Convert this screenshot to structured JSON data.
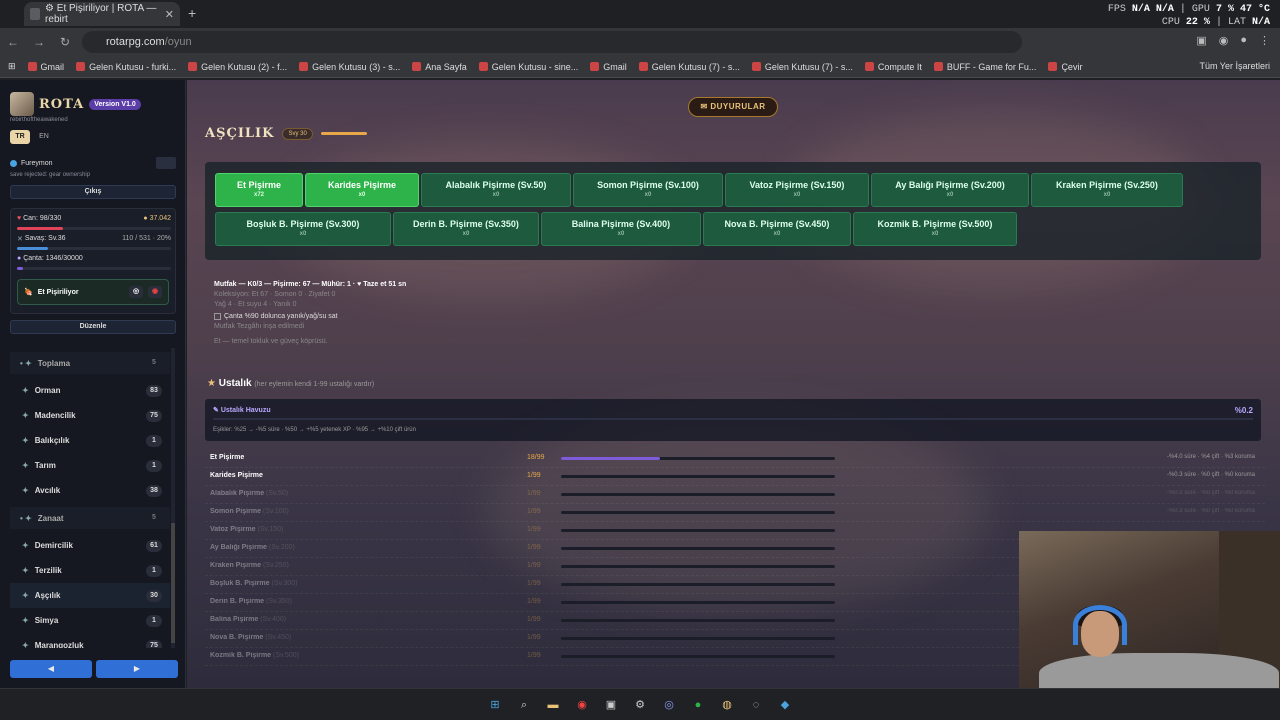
{
  "browser": {
    "tab_title": "⚙ Et Pişiriliyor | ROTA — rebirt",
    "url_host": "rotarpg.com",
    "url_path": "/oyun",
    "overlay": {
      "fps_label": "FPS",
      "fps1": "N/A",
      "fps2": "N/A",
      "gpu_label": "GPU",
      "gpu": "7 %",
      "temp": "47 °C",
      "cpu_label": "CPU",
      "cpu": "22 %",
      "lat_label": "LAT",
      "lat": "N/A"
    },
    "bookmarks": [
      "Gmail",
      "Gelen Kutusu - furki...",
      "Gelen Kutusu (2) - f...",
      "Gelen Kutusu (3) - s...",
      "Ana Sayfa",
      "Gelen Kutusu - sine...",
      "Gmail",
      "Gelen Kutusu (7) - s...",
      "Gelen Kutusu (7) - s...",
      "Compute It",
      "BUFF - Game for Fu...",
      "Çevir"
    ],
    "bookmarks_right": "Tüm Yer İşaretleri"
  },
  "sidebar": {
    "logo": "ROTA",
    "version": "Version V1.0",
    "username_small": "rebirthoftheawakened",
    "lang_tr": "TR",
    "lang_en": "EN",
    "user": "Fureymon",
    "warning": "save rejected: gear ownership",
    "logout": "Çıkış",
    "hp": "Can: 98/330",
    "gold": "37.042",
    "combat": "Savaş: Sv.36",
    "combat_xp": "110 / 531 · 20%",
    "bag": "Çanta: 1346/30000",
    "cooking_status": "Et Pişiriliyor",
    "edit": "Düzenle",
    "skills": [
      {
        "group": true,
        "label": "Toplama",
        "count": "5"
      },
      {
        "label": "Orman",
        "count": "83"
      },
      {
        "label": "Madencilik",
        "count": "75"
      },
      {
        "label": "Balıkçılık",
        "count": "1"
      },
      {
        "label": "Tarım",
        "count": "1"
      },
      {
        "label": "Avcılık",
        "count": "38"
      },
      {
        "group": true,
        "label": "Zanaat",
        "count": "5"
      },
      {
        "label": "Demircilik",
        "count": "61"
      },
      {
        "label": "Terzilik",
        "count": "1"
      },
      {
        "label": "Aşçılık",
        "count": "30"
      },
      {
        "label": "Simya",
        "count": "1"
      },
      {
        "label": "Marangozluk",
        "count": "75"
      }
    ]
  },
  "main": {
    "announcements": "Duyurular",
    "title": "AŞÇILIK",
    "level": "Svy 30",
    "recipes_row1": [
      {
        "label": "Et Pişirme",
        "sub": "x72",
        "active": true
      },
      {
        "label": "Karides Pişirme",
        "sub": "x0",
        "active": true
      },
      {
        "label": "Alabalık Pişirme (Sv.50)",
        "sub": "x0"
      },
      {
        "label": "Somon Pişirme (Sv.100)",
        "sub": "x0"
      },
      {
        "label": "Vatoz Pişirme (Sv.150)",
        "sub": "x0"
      },
      {
        "label": "Ay Balığı Pişirme (Sv.200)",
        "sub": "x0"
      },
      {
        "label": "Kraken Pişirme (Sv.250)",
        "sub": "x0"
      }
    ],
    "recipes_row2": [
      {
        "label": "Boşluk B. Pişirme (Sv.300)",
        "sub": "x0"
      },
      {
        "label": "Derin B. Pişirme (Sv.350)",
        "sub": "x0"
      },
      {
        "label": "Balina Pişirme (Sv.400)",
        "sub": "x0"
      },
      {
        "label": "Nova B. Pişirme (Sv.450)",
        "sub": "x0"
      },
      {
        "label": "Kozmik B. Pişirme (Sv.500)",
        "sub": "x0"
      }
    ],
    "kitchen_line": "Mutfak — K0/3 — Pişirme: 67 — Mühür: 1 · ♥ Taze et 51 sn",
    "collection_line": "Koleksiyon: Et 67 · Somon 0 · Ziyafet 0",
    "stock_line": "Yağ 4 · Et suyu 4 · Yanık 0",
    "checkbox_label": "Çanta %90 dolunca yanık/yağ/su sat",
    "bench_line": "Mutfak Tezgâhı inşa edilmedi",
    "desc_line": "Et — temel tokluk ve güveç köprüsü.",
    "mastery_title": "Ustalık",
    "mastery_sub": "(her eylemin kendi 1-99 ustalığı vardır)",
    "pool_title": "Ustalık Havuzu",
    "pool_pct": "%0.2",
    "thresholds": "Eşikler: %25 → -%5 süre · %50 → +%5 yetenek XP · %95 → +%10 çift ürün",
    "mastery_rows": [
      {
        "name": "Et Pişirme",
        "sv": "",
        "val": "18/99",
        "prog": 0.36,
        "eff": "-%4.0 süre · %4 çift · %3 koruma",
        "dim": false
      },
      {
        "name": "Karides Pişirme",
        "sv": "",
        "val": "1/99",
        "prog": 0.0,
        "eff": "-%0.3 süre · %0 çift · %0 koruma",
        "dim": false
      },
      {
        "name": "Alabalık Pişirme",
        "sv": "(Sv.50)",
        "val": "1/99",
        "prog": 0.0,
        "eff": "-%0.3 süre · %0 çift · %0 koruma",
        "dim": true
      },
      {
        "name": "Somon Pişirme",
        "sv": "(Sv.100)",
        "val": "1/99",
        "prog": 0.0,
        "eff": "-%0.3 süre · %0 çift · %0 koruma",
        "dim": true
      },
      {
        "name": "Vatoz Pişirme",
        "sv": "(Sv.150)",
        "val": "1/99",
        "prog": 0.0,
        "eff": "",
        "dim": true
      },
      {
        "name": "Ay Balığı Pişirme",
        "sv": "(Sv.200)",
        "val": "1/99",
        "prog": 0.0,
        "eff": "",
        "dim": true
      },
      {
        "name": "Kraken Pişirme",
        "sv": "(Sv.250)",
        "val": "1/99",
        "prog": 0.0,
        "eff": "",
        "dim": true
      },
      {
        "name": "Boşluk B. Pişirme",
        "sv": "(Sv.300)",
        "val": "1/99",
        "prog": 0.0,
        "eff": "",
        "dim": true
      },
      {
        "name": "Derin B. Pişirme",
        "sv": "(Sv.350)",
        "val": "1/99",
        "prog": 0.0,
        "eff": "",
        "dim": true
      },
      {
        "name": "Balina Pişirme",
        "sv": "(Sv.400)",
        "val": "1/99",
        "prog": 0.0,
        "eff": "",
        "dim": true
      },
      {
        "name": "Nova B. Pişirme",
        "sv": "(Sv.450)",
        "val": "1/99",
        "prog": 0.0,
        "eff": "",
        "dim": true
      },
      {
        "name": "Kozmik B. Pişirme",
        "sv": "(Sv.500)",
        "val": "1/99",
        "prog": 0.0,
        "eff": "",
        "dim": true
      }
    ]
  },
  "colors": {
    "accent": "#2db34a",
    "purple": "#7e5bd8",
    "gold": "#e9c27a"
  }
}
